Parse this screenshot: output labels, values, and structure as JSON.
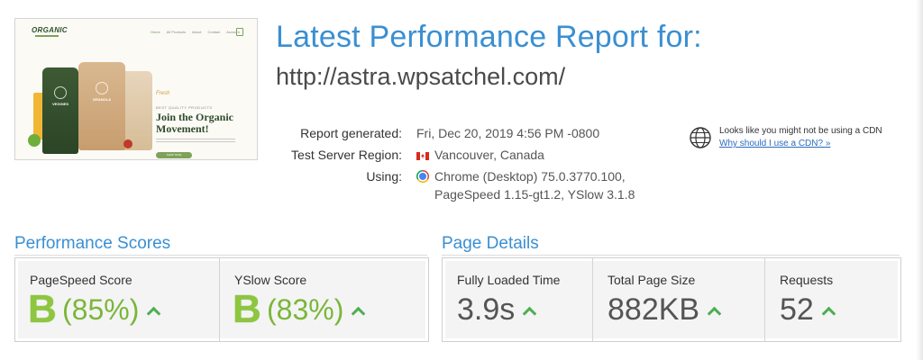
{
  "thumbnail": {
    "logo": "ORGANIC",
    "nav": [
      "Home",
      "All Products",
      "About",
      "Contact",
      "Account"
    ],
    "tagline": "Fresh",
    "kicker": "BEST QUALITY PRODUCTS",
    "hero_title": "Join the Organic Movement!",
    "packs": [
      "VEGGIES",
      "GRANOLA",
      ""
    ],
    "shop_button": "SHOP NOW"
  },
  "header": {
    "title": "Latest Performance Report for:",
    "url": "http://astra.wpsatchel.com/"
  },
  "report": {
    "generated_label": "Report generated:",
    "generated_value": "Fri, Dec 20, 2019 4:56 PM -0800",
    "region_label": "Test Server Region:",
    "region_value": "Vancouver, Canada",
    "using_label": "Using:",
    "using_line1": "Chrome (Desktop) 75.0.3770.100,",
    "using_line2": "PageSpeed 1.15-gt1.2, YSlow 3.1.8"
  },
  "cdn": {
    "text": "Looks like you might not be using a CDN",
    "link": "Why should I use a CDN? »"
  },
  "performance": {
    "title": "Performance Scores",
    "pagespeed": {
      "label": "PageSpeed Score",
      "grade": "B",
      "percent": "(85%)"
    },
    "yslow": {
      "label": "YSlow Score",
      "grade": "B",
      "percent": "(83%)"
    }
  },
  "details": {
    "title": "Page Details",
    "load": {
      "label": "Fully Loaded Time",
      "value": "3.9s"
    },
    "size": {
      "label": "Total Page Size",
      "value": "882KB"
    },
    "requests": {
      "label": "Requests",
      "value": "52"
    }
  },
  "colors": {
    "accent_blue": "#3a8fd2",
    "grade_green": "#8dc63f",
    "trend_green": "#4caf50"
  }
}
